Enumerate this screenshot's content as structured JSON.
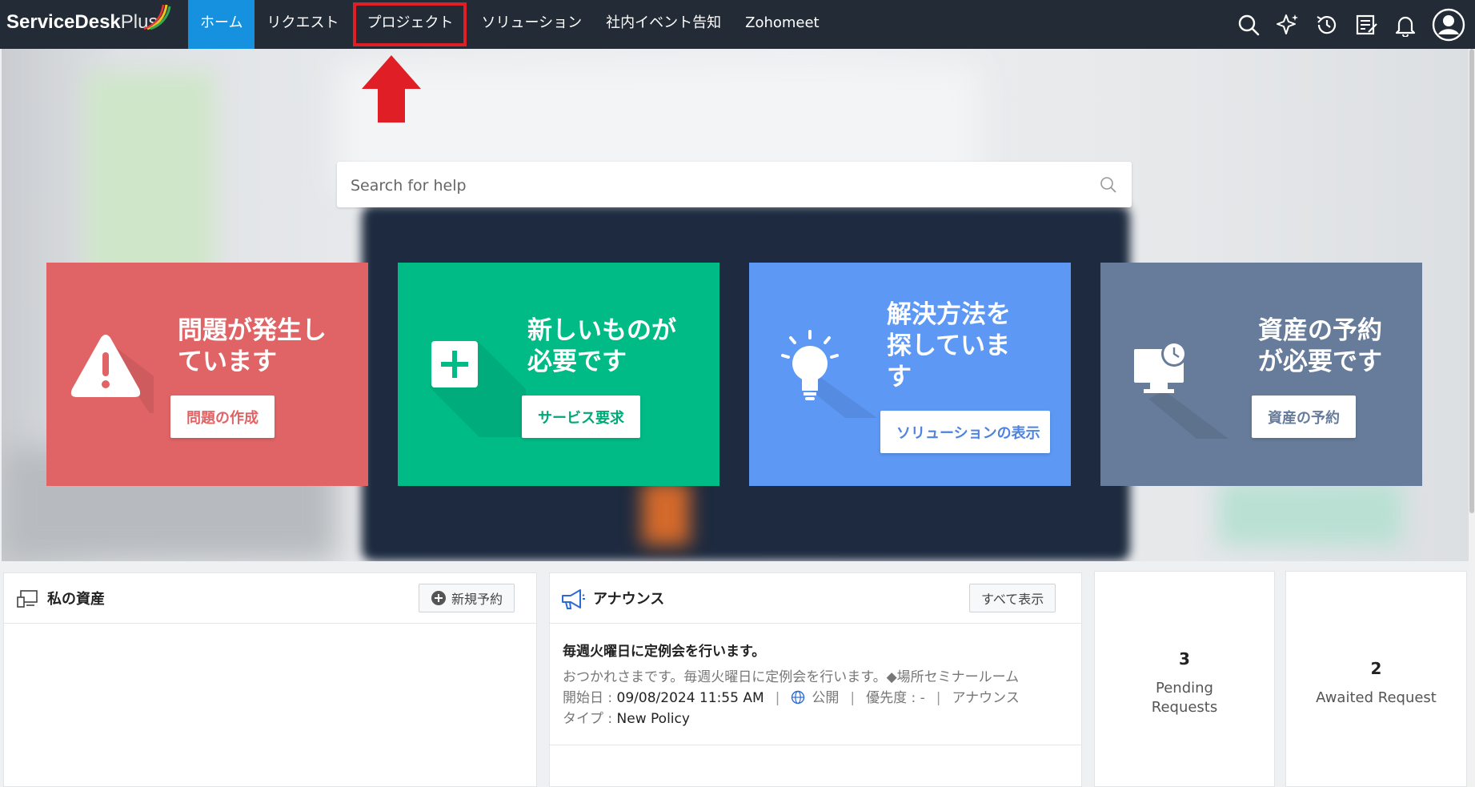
{
  "app": {
    "logo_main": "ServiceDesk",
    "logo_plus": "Plus"
  },
  "nav": [
    {
      "label": "ホーム"
    },
    {
      "label": "リクエスト"
    },
    {
      "label": "プロジェクト"
    },
    {
      "label": "ソリューション"
    },
    {
      "label": "社内イベント告知"
    },
    {
      "label": "Zohomeet"
    }
  ],
  "top_icons": [
    "search-icon",
    "sparkle-icon",
    "history-icon",
    "notes-icon",
    "bell-icon",
    "user-avatar-icon"
  ],
  "search": {
    "placeholder": "Search for help"
  },
  "cards": [
    {
      "title_line1": "問題が発生し",
      "title_line2": "ています",
      "button": "問題の作成",
      "color": "#e06466"
    },
    {
      "title_line1": "新しいものが",
      "title_line2": "必要です",
      "button": "サービス要求",
      "color": "#00bb86"
    },
    {
      "title_line1": "解決方法を",
      "title_line2": "探していま",
      "title_line3": "す",
      "button": "ソリューションの表示",
      "color": "#5d98f5"
    },
    {
      "title_line1": "資産の予約",
      "title_line2": "が必要です",
      "button": "資産の予約",
      "color": "#667c9a"
    }
  ],
  "assets_panel": {
    "title": "私の資産",
    "button": "新規予約"
  },
  "announcements": {
    "title": "アナウンス",
    "view_all": "すべて表示",
    "item": {
      "title": "毎週火曜日に定例会を行います。",
      "description": "おつかれさまです。毎週火曜日に定例会を行います。◆場所セミナールーム",
      "start_label": "開始日 : ",
      "start_value": "09/08/2024 11:55 AM",
      "visibility": "公開",
      "priority": "優先度 : -",
      "type_prefix": "アナウンス",
      "type_label": "タイプ : ",
      "type_value": "New Policy"
    }
  },
  "stats": [
    {
      "count": "3",
      "label_line1": "Pending",
      "label_line2": "Requests"
    },
    {
      "count": "2",
      "label_line1": "Awaited Request"
    }
  ],
  "annotation": {
    "highlight_color": "#e01e26"
  }
}
